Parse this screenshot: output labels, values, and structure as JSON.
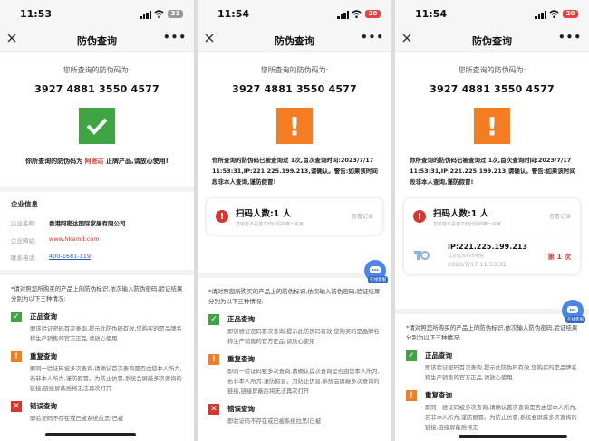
{
  "screens": [
    {
      "time": "11:53",
      "battery": "31",
      "title": "防伪查询",
      "code_label": "您所查询的防伪码为:",
      "code": "3927 4881 3550 4577",
      "result_prefix": "你所查询的防伪码为",
      "result_name": "阿密达",
      "result_suffix": "正牌产品,请放心使用!",
      "company": {
        "heading": "企业信息",
        "rows": [
          {
            "key": "企业名称:",
            "value": "香港阿密达国际家居有限公司"
          },
          {
            "key": "企业网站:",
            "value": "www.hkamd.com"
          },
          {
            "key": "联系电话:",
            "value": "400-1681-119"
          }
        ]
      },
      "intro": "*请对照您所购买的产品上的防伪标识,依次输入防伪密码,验证结果分别为以下三种情况:",
      "items": [
        {
          "title": "正品查询",
          "desc": "即该验证密码首次查询,提示此防伪码有效,您购买的是品牌名称生产销售的官方正品,请放心使用"
        },
        {
          "title": "重复查询",
          "desc": "即同一验证码被多次查询,请确认首次查询是否由您本人所为,若非本人所为,谨防假冒。为防止仿冒,系统会屏蔽多次查询的链接,链接屏蔽后将无法再次打开"
        },
        {
          "title": "错误查询",
          "desc": "即验证码不存在或已被系统拉黑(已被"
        }
      ]
    },
    {
      "time": "11:54",
      "battery": "20",
      "title": "防伪查询",
      "code_label": "您所查询的防伪码为:",
      "code": "3927 4881 3550 4577",
      "warning": "你所查询的防伪码已被查询过 1次,首次查询时间:2023/7/17 11:53:31,IP:221.225.199.213,请确认。警告:如果该时间段非本人查询,谨防假冒!",
      "scan": {
        "label": "扫码人数:1 人",
        "sub": "您可能不是首次扫此码的唯一买家",
        "view": "查看记录"
      },
      "cs_label": "在线客服",
      "intro": "*请对照您所购买的产品上的防伪标识,依次输入防伪密码,验证结果分别为以下三种情况:",
      "items": [
        {
          "title": "正品查询",
          "desc": "即该验证密码首次查询,提示此防伪码有效,您购买的是品牌名称生产销售的官方正品,请放心使用"
        },
        {
          "title": "重复查询",
          "desc": "即同一验证码被多次查询,请确认首次查询是否由您本人所为,若非本人所为,谨防假冒。为防止仿冒,系统会屏蔽多次查询的链接,链接屏蔽后将无法再次打开"
        },
        {
          "title": "错误查询",
          "desc": "即验证码不存在或已被系统拉黑(已被"
        }
      ]
    },
    {
      "time": "11:54",
      "battery": "20",
      "title": "防伪查询",
      "code_label": "您所查询的防伪码为:",
      "code": "3927 4881 3550 4577",
      "warning": "你所查询的防伪码已被查询过 1次,首次查询时间:2023/7/17 11:53:31,IP:221.225.199.213,请确认。警告:如果该时间段非本人查询,谨防假冒!",
      "scan": {
        "label": "扫码人数:1 人",
        "sub": "您可能不是首次扫此码的唯一买家",
        "view": "查看记录"
      },
      "record": {
        "ip": "IP:221.225.199.213",
        "location": "江苏省苏州市电信",
        "time": "2023/7/17 11:53:31",
        "count": "第 1 次"
      },
      "cs_label": "在线客服",
      "intro": "*请对照您所购买的产品上的防伪标识,依次输入防伪密码,验证结果分别为以下三种情况:",
      "items": [
        {
          "title": "正品查询",
          "desc": "即该验证密码首次查询,提示此防伪码有效,您购买的是品牌名称生产销售的官方正品,请放心使用"
        },
        {
          "title": "重复查询",
          "desc": "即同一验证码被多次查询,请确认首次查询是否由您本人所为,若非本人所为,谨防假冒。为防止仿冒,系统会屏蔽多次查询的链接,链接屏蔽后将无"
        }
      ]
    }
  ],
  "colors": {
    "green": "#3fa442",
    "orange": "#f47d22",
    "red": "#d9362f",
    "link": "#2a5db8"
  },
  "icons": [
    "close-icon",
    "more-icon",
    "signal-icon",
    "wifi-icon",
    "battery-icon",
    "check-icon",
    "exclamation-icon",
    "cross-icon",
    "customer-service-icon",
    "logo-icon"
  ]
}
